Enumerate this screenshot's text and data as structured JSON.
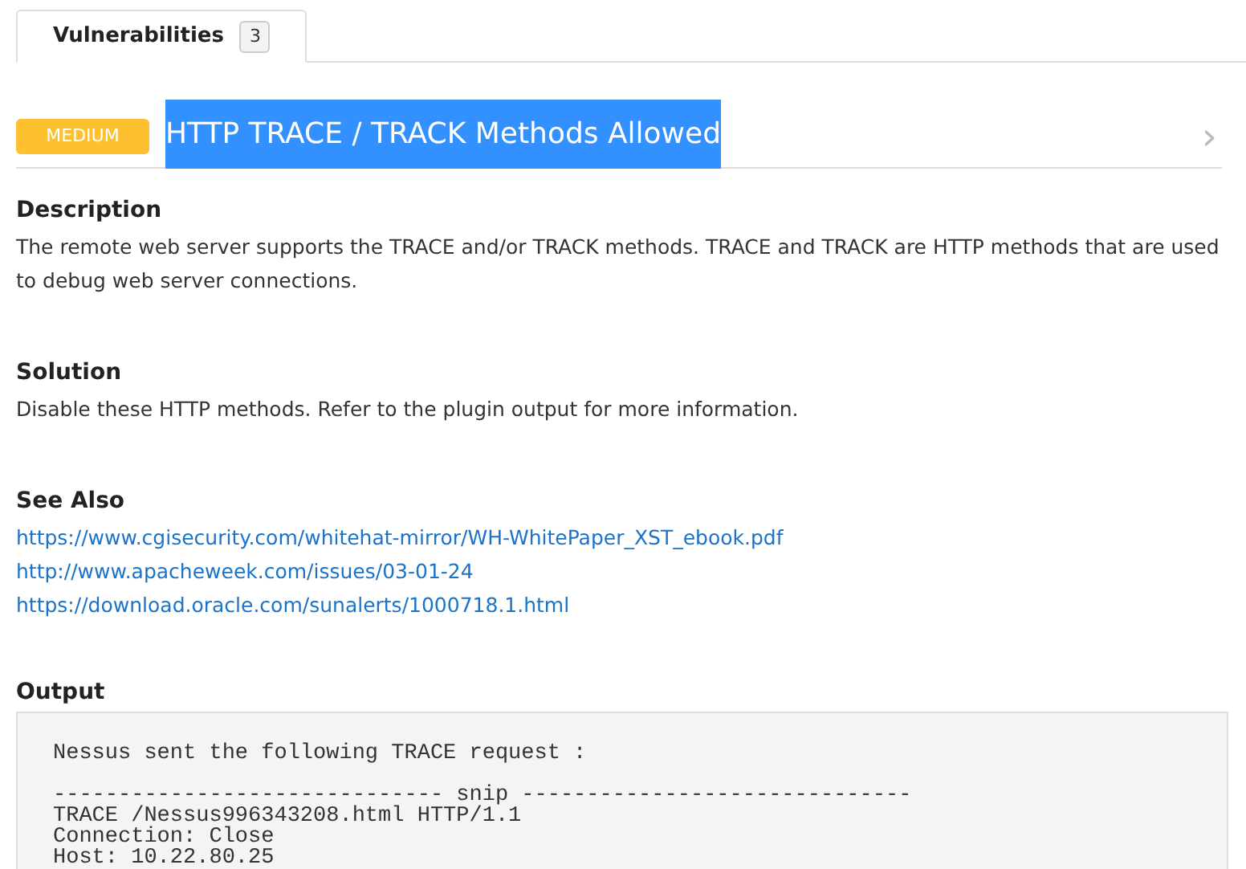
{
  "tabs": [
    {
      "label": "Vulnerabilities",
      "count": "3",
      "selected": true
    }
  ],
  "vulnerability": {
    "severity": "MEDIUM",
    "title": "HTTP TRACE / TRACK Methods Allowed",
    "title_selected": true,
    "chevron": "›"
  },
  "sections": [
    {
      "kind": "text",
      "heading": "Description",
      "text": "The remote web server supports the TRACE and/or TRACK methods. TRACE and TRACK are HTTP methods that are used to debug web server connections."
    },
    {
      "kind": "text",
      "heading": "Solution",
      "text": "Disable these HTTP methods. Refer to the plugin output for more information."
    },
    {
      "kind": "links",
      "heading": "See Also",
      "links": [
        "https://www.cgisecurity.com/whitehat-mirror/WH-WhitePaper_XST_ebook.pdf",
        "http://www.apacheweek.com/issues/03-01-24",
        "https://download.oracle.com/sunalerts/1000718.1.html"
      ]
    },
    {
      "kind": "output",
      "heading": "Output",
      "blocks": [
        [
          "Nessus sent the following TRACE request :"
        ],
        [
          "------------------------------ snip ------------------------------",
          "TRACE /Nessus996343208.html HTTP/1.1",
          "Connection: Close",
          "Host: 10.22.80.25"
        ]
      ]
    }
  ]
}
